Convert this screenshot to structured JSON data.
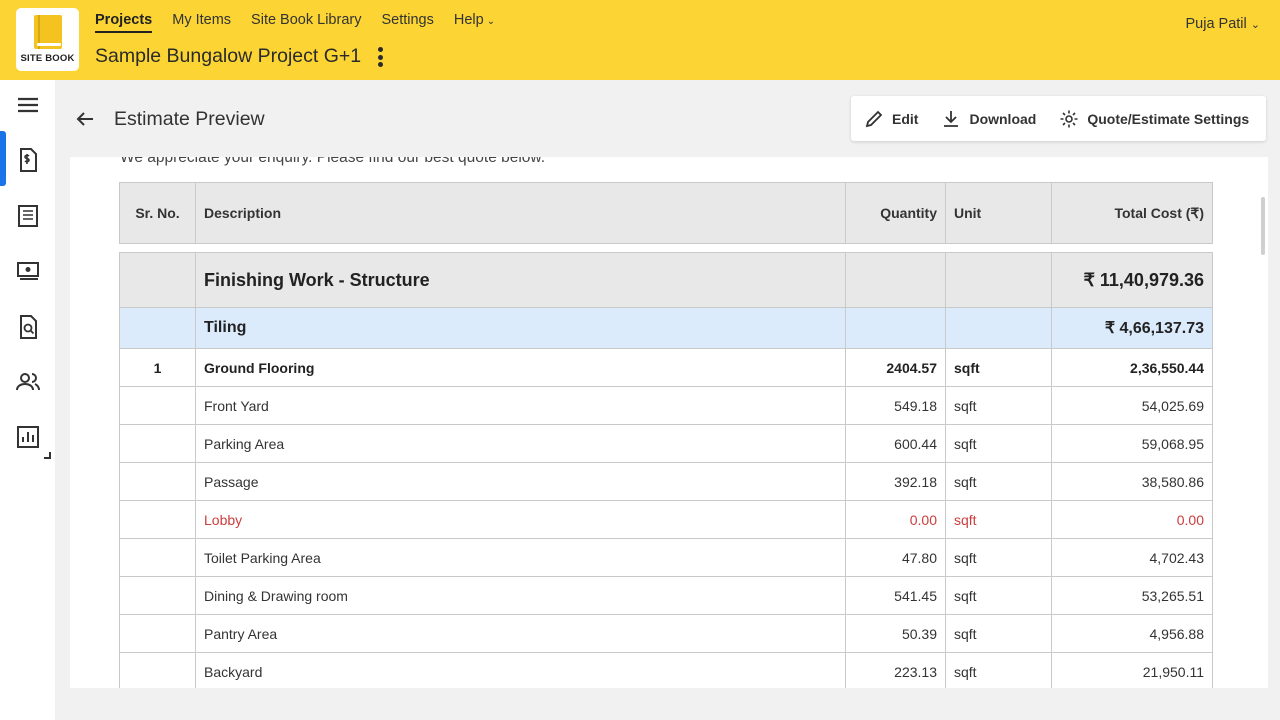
{
  "header": {
    "logo_text": "SITE BOOK",
    "nav": [
      {
        "label": "Projects",
        "active": true
      },
      {
        "label": "My Items"
      },
      {
        "label": "Site Book Library"
      },
      {
        "label": "Settings"
      },
      {
        "label": "Help",
        "has_dropdown": true
      }
    ],
    "project_title": "Sample Bungalow Project G+1",
    "user_name": "Puja Patil",
    "background_color": "#fcd535"
  },
  "sidebar": {
    "active_color": "#1a73e8",
    "icons": [
      "menu-icon",
      "estimate-icon",
      "bill-icon",
      "payment-icon",
      "document-search-icon",
      "team-icon",
      "report-icon"
    ]
  },
  "page": {
    "title": "Estimate Preview",
    "toolbar": {
      "edit_label": "Edit",
      "download_label": "Download",
      "settings_label": "Quote/Estimate Settings"
    },
    "intro_text": "We appreciate your enquiry. Please find our best quote below."
  },
  "table": {
    "headers": [
      "Sr. No.",
      "Description",
      "Quantity",
      "Unit",
      "Total Cost (₹)"
    ],
    "section": {
      "description": "Finishing Work - Structure",
      "total": "₹ 11,40,979.36"
    },
    "subsection": {
      "description": "Tiling",
      "total": "₹ 4,66,137.73"
    },
    "item": {
      "sr": "1",
      "description": "Ground Flooring",
      "quantity": "2404.57",
      "unit": "sqft",
      "total": "2,36,550.44"
    },
    "rows": [
      {
        "description": "Front Yard",
        "quantity": "549.18",
        "unit": "sqft",
        "total": "54,025.69"
      },
      {
        "description": "Parking Area",
        "quantity": "600.44",
        "unit": "sqft",
        "total": "59,068.95"
      },
      {
        "description": "Passage",
        "quantity": "392.18",
        "unit": "sqft",
        "total": "38,580.86"
      },
      {
        "description": "Lobby",
        "quantity": "0.00",
        "unit": "sqft",
        "total": "0.00"
      },
      {
        "description": "Toilet Parking Area",
        "quantity": "47.80",
        "unit": "sqft",
        "total": "4,702.43"
      },
      {
        "description": "Dining & Drawing room",
        "quantity": "541.45",
        "unit": "sqft",
        "total": "53,265.51"
      },
      {
        "description": "Pantry Area",
        "quantity": "50.39",
        "unit": "sqft",
        "total": "4,956.88"
      },
      {
        "description": "Backyard",
        "quantity": "223.13",
        "unit": "sqft",
        "total": "21,950.11"
      }
    ]
  }
}
